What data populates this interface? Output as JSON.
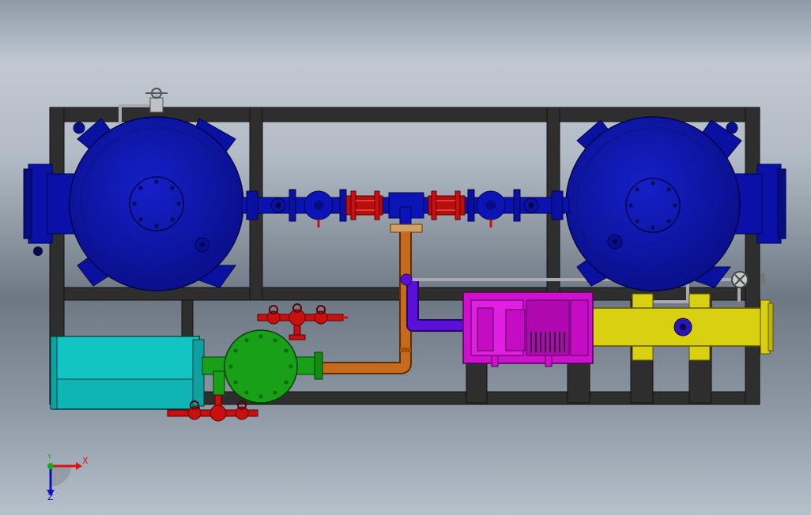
{
  "triad": {
    "x_label": "X",
    "y_label": "Y",
    "z_label": "Z"
  },
  "colors": {
    "background_top": "#8e9aa8",
    "background_bottom": "#b7c1cc",
    "frame": "#2b2b2b",
    "vessel": "#0a0fa0",
    "valve": "#c81010",
    "pipe_orange": "#c66b1e",
    "pipe_violet": "#5a10d8",
    "pump": "#0fb4b4",
    "filter_housing": "#18a018",
    "compressor": "#d010d0",
    "heat_exchanger": "#d8d010",
    "instrument_line": "#a8aab0",
    "axis_x": "#e01010",
    "axis_y": "#10b010",
    "axis_z": "#1010c0"
  }
}
